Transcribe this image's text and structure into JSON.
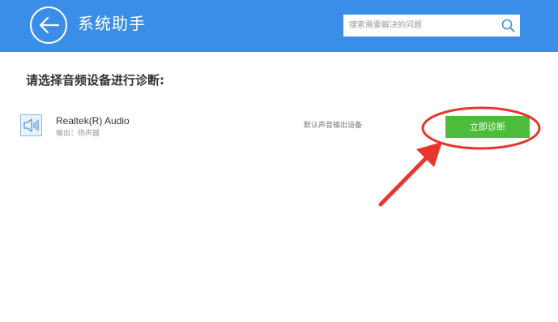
{
  "header": {
    "title": "系统助手",
    "search": {
      "placeholder": "搜索需要解决的问题",
      "icon": "search-icon"
    },
    "back_icon": "back-arrow-icon",
    "background_color": "#3b8ee8"
  },
  "main": {
    "section_title": "请选择音频设备进行诊断:",
    "devices": [
      {
        "icon": "speaker-icon",
        "name": "Realtek(R) Audio",
        "subtitle": "输出：扬声器",
        "default_label": "默认声音输出设备",
        "action_label": "立即诊断"
      }
    ]
  },
  "colors": {
    "accent_blue": "#3b8ee8",
    "button_green": "#4cbd3a",
    "annotation_red": "#e8362f"
  }
}
